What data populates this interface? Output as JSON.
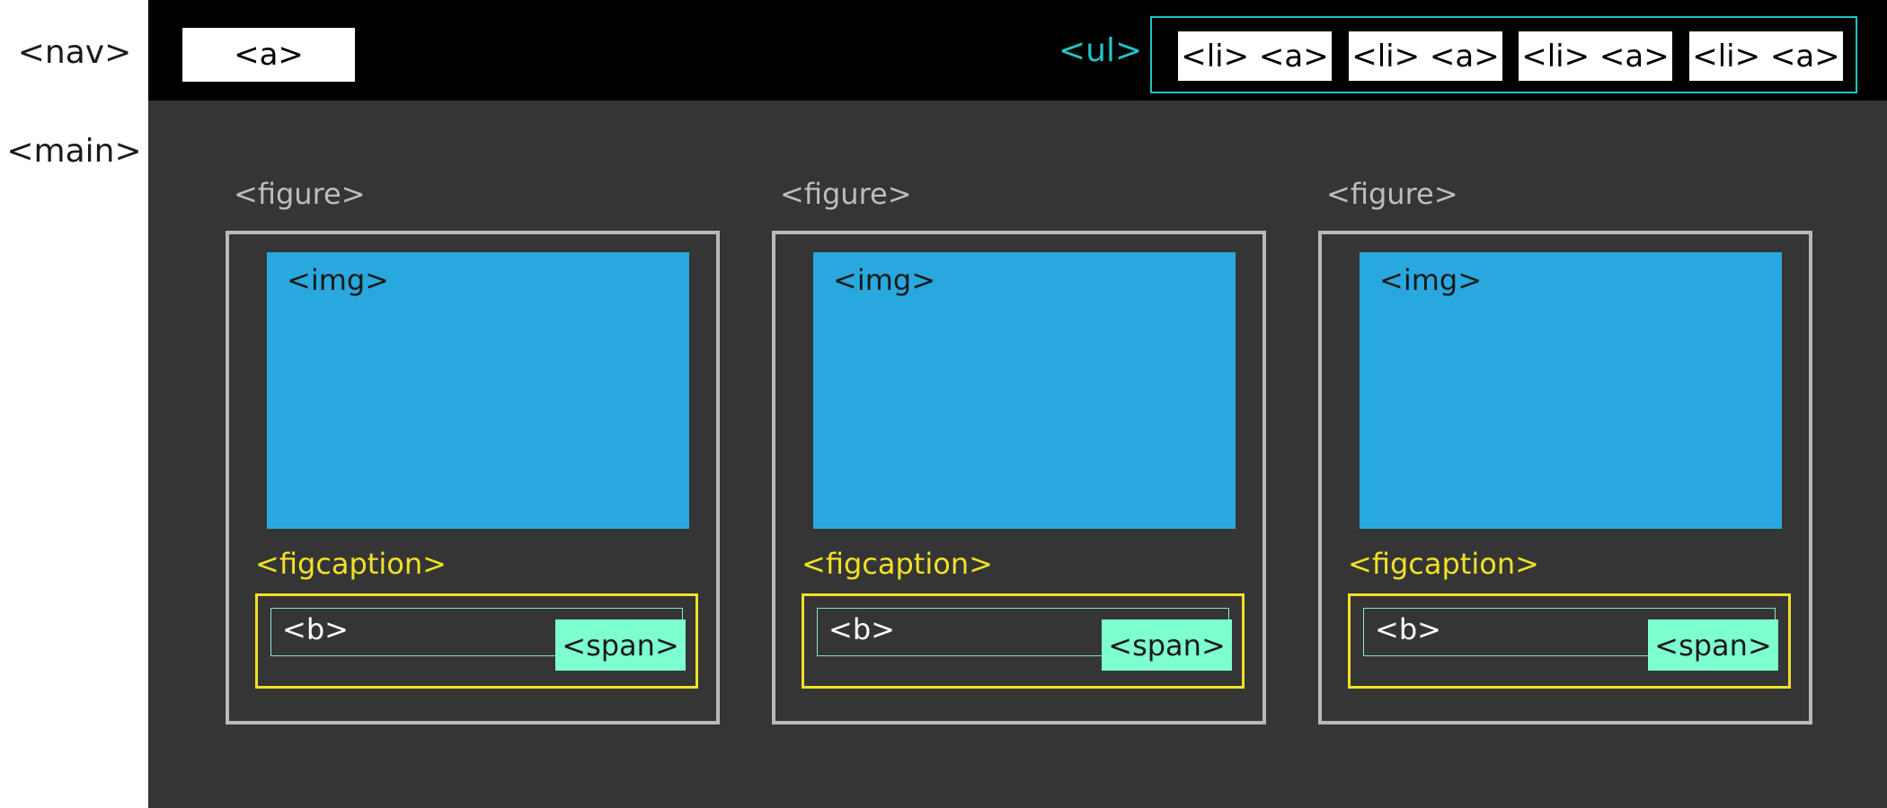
{
  "labels": {
    "nav": "<nav>",
    "main": "<main>"
  },
  "nav": {
    "brand_link": "<a>",
    "ul_label": "<ul>",
    "items": [
      {
        "label": "<li> <a>"
      },
      {
        "label": "<li> <a>"
      },
      {
        "label": "<li> <a>"
      },
      {
        "label": "<li> <a>"
      }
    ]
  },
  "figures": [
    {
      "figure_label": "<figure>",
      "img_label": "<img>",
      "figcaption_label": "<figcaption>",
      "b_label": "<b>",
      "span_label": "<span>"
    },
    {
      "figure_label": "<figure>",
      "img_label": "<img>",
      "figcaption_label": "<figcaption>",
      "b_label": "<b>",
      "span_label": "<span>"
    },
    {
      "figure_label": "<figure>",
      "img_label": "<img>",
      "figcaption_label": "<figcaption>",
      "b_label": "<b>",
      "span_label": "<span>"
    }
  ],
  "colors": {
    "nav_background": "#000000",
    "main_background": "#353535",
    "ul_accent": "#23c2c4",
    "figure_border": "#b9b9b9",
    "img_fill": "#29a8e0",
    "figcaption_accent": "#f0e129",
    "span_fill": "#7dffcf"
  }
}
